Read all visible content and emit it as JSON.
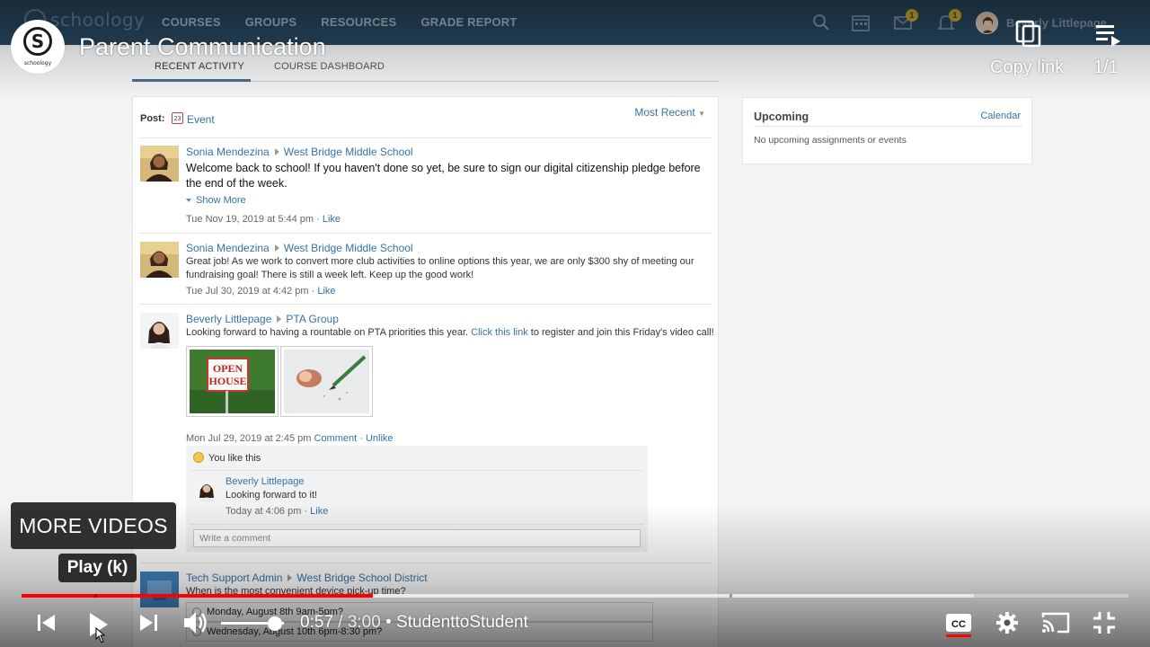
{
  "app": {
    "logo": "schoology",
    "nav": [
      "COURSES",
      "GROUPS",
      "RESOURCES",
      "GRADE REPORT"
    ],
    "mail_badge": "1",
    "notif_badge": "1",
    "user_name": "Beverly Littlepage"
  },
  "course": {
    "tabs": [
      "RECENT ACTIVITY",
      "COURSE DASHBOARD"
    ],
    "post_label": "Post:",
    "event_label": "Event",
    "calendar_day": "23",
    "sort_label": "Most Recent"
  },
  "updates": [
    {
      "author": "Sonia Mendezina",
      "target": "West Bridge Middle School",
      "body": "Welcome back to school! If you haven't done so yet, be sure to sign our digital citizenship pledge before the end of the week.",
      "show_more": "Show More",
      "meta": "Tue Nov 19, 2019 at 5:44 pm",
      "actions": "· Like"
    },
    {
      "author": "Sonia Mendezina",
      "target": "West Bridge Middle School",
      "body": "Great job!  As we work to convert more club activities to online options this year, we are only $300 shy of meeting our fundraising goal! There is still a week left.  Keep up the good work!",
      "meta": "Tue Jul 30, 2019 at 4:42 pm",
      "actions": "· Like"
    },
    {
      "author": "Beverly Littlepage",
      "target": "PTA Group",
      "body_before": "Looking forward to having a rountable on PTA priorities this year.  ",
      "body_link": "Click this link",
      "body_after": " to register and join this Friday's video call!",
      "image1_text_line1": "OPEN",
      "image1_text_line2": "HOUSE",
      "meta": "Mon Jul 29, 2019 at 2:45 pm",
      "action_comment": "Comment",
      "action_unlike": "· Unlike",
      "likes_text": "You like this",
      "comment": {
        "author": "Beverly Littlepage",
        "text": "Looking forward to it!",
        "meta": "Today at 4:06 pm",
        "action": "· Like"
      },
      "write_placeholder": "Write a comment"
    },
    {
      "author": "Tech Support Admin",
      "target": "West Bridge School District",
      "body": "When is the most convenient device pick-up time?",
      "poll_options": [
        "Monday, August 8th 9am-5pm?",
        "Wednesday, August 10th 6pm-8:30 pm?"
      ]
    }
  ],
  "sidebar": {
    "title": "Upcoming",
    "link": "Calendar",
    "empty_text": "No upcoming assignments or events"
  },
  "player": {
    "channel_logo_letter": "S",
    "channel_logo_word": "schoology",
    "video_title": "Parent Communication",
    "copy_link_label": "Copy link",
    "playlist_count": "1/1",
    "more_videos_label": "MORE VIDEOS",
    "tooltip": "Play (k)",
    "current_time": "0:57",
    "separator": " / ",
    "duration": "3:00",
    "channel_suffix": " • StudenttoStudent",
    "progress_fraction": 0.317,
    "buffered_fraction": 0.86,
    "volume_fraction": 0.85,
    "accent_color": "#ff0000"
  }
}
